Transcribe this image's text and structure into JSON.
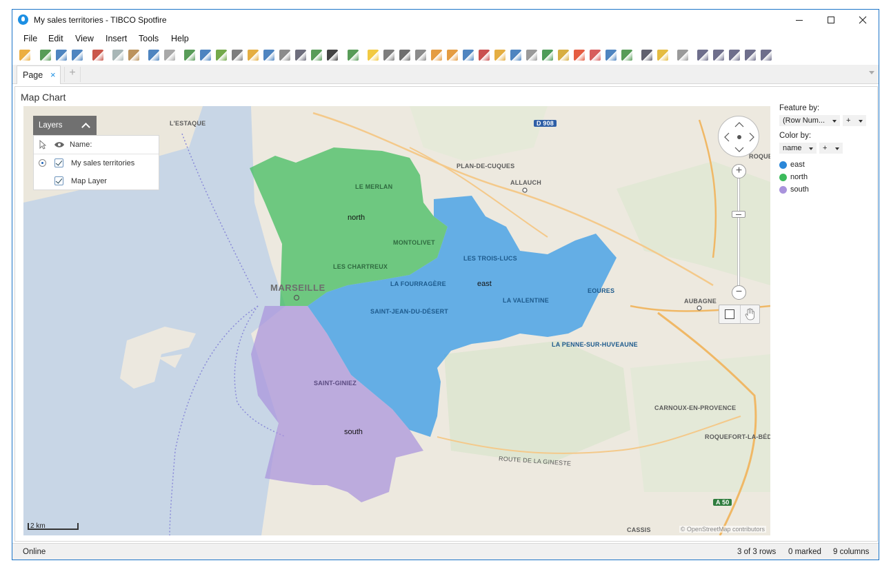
{
  "window": {
    "title": "My sales territories - TIBCO Spotfire"
  },
  "menu": [
    "File",
    "Edit",
    "View",
    "Insert",
    "Tools",
    "Help"
  ],
  "toolbar_icons": [
    "open-icon",
    "add-data-icon",
    "replace-data-icon",
    "save-icon",
    "export-pdf-icon",
    "copy-icon",
    "paste-icon",
    "undo-icon",
    "redo-icon",
    "reset-icon",
    "filter-icon",
    "details-icon",
    "data-table-icon",
    "tags-icon",
    "bookmark-icon",
    "lists-icon",
    "data-panel-icon",
    "comments-icon",
    "color-scheme-icon",
    "new-visualization-icon",
    "insights-icon",
    "table-icon",
    "cross-table-icon",
    "graphical-table-icon",
    "bar-chart-icon",
    "combination-chart-icon",
    "line-chart-icon",
    "multi-line-icon",
    "pie-chart-icon",
    "scatter-plot-icon",
    "3d-scatter-icon",
    "map-chart-icon",
    "treemap-icon",
    "heat-map-icon",
    "parallel-coordinates-icon",
    "summary-table-icon",
    "box-plot-icon",
    "text-area-icon",
    "text-icon",
    "settings-icon",
    "layout-tile-icon",
    "layout-grid-icon",
    "layout-columns-icon",
    "layout-rows-icon",
    "maximize-icon"
  ],
  "tabs": {
    "page_label": "Page",
    "close": "×",
    "add": "+"
  },
  "viz": {
    "title": "Map Chart"
  },
  "layers": {
    "title": "Layers",
    "name_header": "Name:",
    "items": [
      {
        "label": "My sales territories",
        "checked": true,
        "active": true
      },
      {
        "label": "Map Layer",
        "checked": true,
        "active": false
      }
    ]
  },
  "map": {
    "city": "MARSEILLE",
    "labels": [
      "L'ESTAQUE",
      "PLAN-DE-CUQUES",
      "ALLAUCH",
      "LE MERLAN",
      "MONTOLIVET",
      "LES CHARTREUX",
      "LES TROIS-LUCS",
      "LA FOURRAGÈRE",
      "SAINT-JEAN-DU-DÉSERT",
      "LA VALENTINE",
      "EOURES",
      "AUBAGNE",
      "LA PENNE-SUR-HUVEAUNE",
      "SAINT-GINIEZ",
      "CARNOUX-EN-PROVENCE",
      "ROQUEFORT-LA-BÉDOULE",
      "ROUTE DE LA GINESTE",
      "CASSIS",
      "ROQUEV"
    ],
    "road_shields": [
      "D 908",
      "A 50"
    ],
    "territories": [
      {
        "name": "north",
        "color": "#3dbb5b"
      },
      {
        "name": "east",
        "color": "#2f97e8"
      },
      {
        "name": "south",
        "color": "#a993dc"
      }
    ],
    "scale_label": "2 km",
    "attribution": "© OpenStreetMap contributors"
  },
  "legend": {
    "feature_by_title": "Feature by:",
    "feature_by_value": "(Row Num...",
    "color_by_title": "Color by:",
    "color_by_value": "name",
    "plus": "+",
    "items": [
      {
        "label": "east",
        "color": "#2b87d8"
      },
      {
        "label": "north",
        "color": "#3cbb5c"
      },
      {
        "label": "south",
        "color": "#a993dc"
      }
    ]
  },
  "status": {
    "connection": "Online",
    "rows": "3 of 3 rows",
    "marked": "0 marked",
    "columns": "9 columns"
  }
}
